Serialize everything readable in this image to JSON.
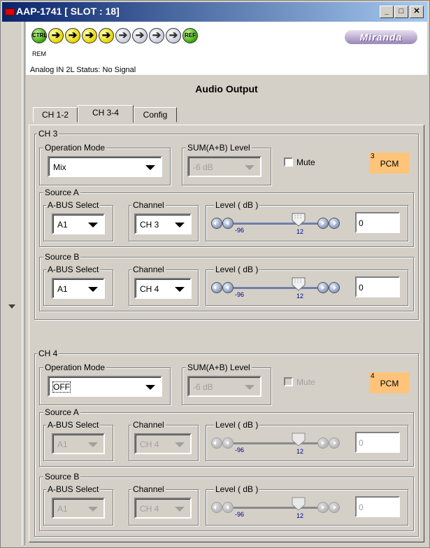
{
  "window": {
    "title": "AAP-1741 [ SLOT : 18]",
    "min_label": "_",
    "max_label": "□",
    "close_label": "✕"
  },
  "header": {
    "ctrl_label": "CTRL",
    "rem_label": "REM",
    "ref_label": "REF",
    "logo_text": "Miranda",
    "status_text": "Analog IN 2L Status: No Signal"
  },
  "panel": {
    "title": "Audio Output",
    "tabs": [
      "CH 1-2",
      "CH 3-4",
      "Config"
    ],
    "active_tab": "CH 3-4"
  },
  "channels": [
    {
      "label": "CH 3",
      "operation_mode_label": "Operation Mode",
      "operation_mode": "Mix",
      "sum_label": "SUM(A+B) Level",
      "sum_value": "-6 dB",
      "mute_label": "Mute",
      "pcm_num": "3",
      "pcm_label": "PCM",
      "sources": [
        {
          "label": "Source A",
          "bus_label": "A-BUS Select",
          "bus": "A1",
          "channel_label": "Channel",
          "channel": "CH 3",
          "level_label": "Level ( dB )",
          "level_min": "-96",
          "level_max": "12",
          "level": "0"
        },
        {
          "label": "Source B",
          "bus_label": "A-BUS Select",
          "bus": "A1",
          "channel_label": "Channel",
          "channel": "CH 4",
          "level_label": "Level ( dB )",
          "level_min": "-96",
          "level_max": "12",
          "level": "0"
        }
      ]
    },
    {
      "label": "CH 4",
      "operation_mode_label": "Operation Mode",
      "operation_mode": "OFF",
      "sum_label": "SUM(A+B) Level",
      "sum_value": "-6 dB",
      "mute_label": "Mute",
      "pcm_num": "4",
      "pcm_label": "PCM",
      "sources": [
        {
          "label": "Source A",
          "bus_label": "A-BUS Select",
          "bus": "A1",
          "channel_label": "Channel",
          "channel": "CH 4",
          "level_label": "Level ( dB )",
          "level_min": "-96",
          "level_max": "12",
          "level": "0"
        },
        {
          "label": "Source B",
          "bus_label": "A-BUS Select",
          "bus": "A1",
          "channel_label": "Channel",
          "channel": "CH 4",
          "level_label": "Level ( dB )",
          "level_min": "-96",
          "level_max": "12",
          "level": "0"
        }
      ]
    }
  ],
  "colors": {
    "title_bar": "#0a246a",
    "pcm_badge": "#ffc47a",
    "led_green": "#3aa10a",
    "led_yellow": "#e6d400"
  },
  "icons": {
    "status_leds": [
      "ctrl-led-green",
      "arrow-led-yellow",
      "arrow-led-yellow",
      "arrow-led-yellow",
      "arrow-led-yellow",
      "arrow-led-gray",
      "arrow-led-gray",
      "arrow-led-gray",
      "arrow-led-gray",
      "ref-led-green"
    ]
  }
}
